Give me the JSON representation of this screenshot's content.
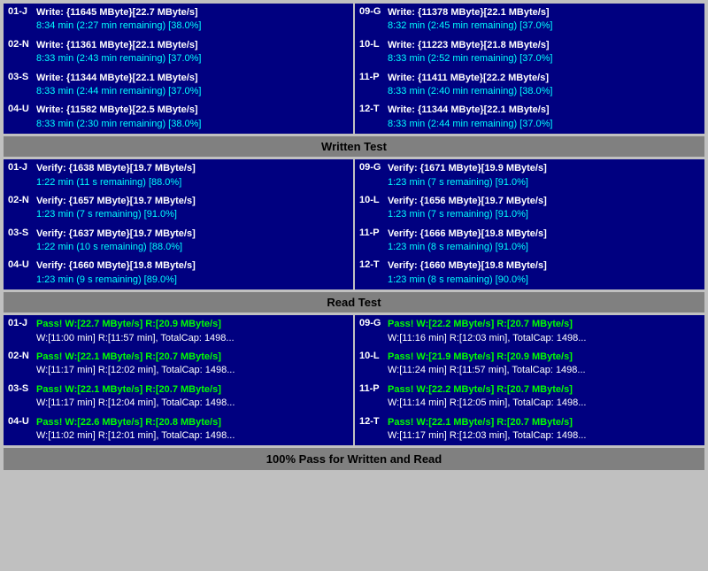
{
  "sections": {
    "write": {
      "rows_left": [
        {
          "label": "01-J",
          "line1": "Write: {11645 MByte}[22.7 MByte/s]",
          "line2": "8:34 min (2:27 min remaining)  [38.0%]"
        },
        {
          "label": "02-N",
          "line1": "Write: {11361 MByte}[22.1 MByte/s]",
          "line2": "8:33 min (2:43 min remaining)  [37.0%]"
        },
        {
          "label": "03-S",
          "line1": "Write: {11344 MByte}[22.1 MByte/s]",
          "line2": "8:33 min (2:44 min remaining)  [37.0%]"
        },
        {
          "label": "04-U",
          "line1": "Write: {11582 MByte}[22.5 MByte/s]",
          "line2": "8:33 min (2:30 min remaining)  [38.0%]"
        }
      ],
      "rows_right": [
        {
          "label": "09-G",
          "line1": "Write: {11378 MByte}[22.1 MByte/s]",
          "line2": "8:32 min (2:45 min remaining)  [37.0%]"
        },
        {
          "label": "10-L",
          "line1": "Write: {11223 MByte}[21.8 MByte/s]",
          "line2": "8:33 min (2:52 min remaining)  [37.0%]"
        },
        {
          "label": "11-P",
          "line1": "Write: {11411 MByte}[22.2 MByte/s]",
          "line2": "8:33 min (2:40 min remaining)  [38.0%]"
        },
        {
          "label": "12-T",
          "line1": "Write: {11344 MByte}[22.1 MByte/s]",
          "line2": "8:33 min (2:44 min remaining)  [37.0%]"
        }
      ],
      "header": "Written Test"
    },
    "verify": {
      "rows_left": [
        {
          "label": "01-J",
          "line1": "Verify: {1638 MByte}[19.7 MByte/s]",
          "line2": "1:22 min (11 s remaining)   [88.0%]"
        },
        {
          "label": "02-N",
          "line1": "Verify: {1657 MByte}[19.7 MByte/s]",
          "line2": "1:23 min (7 s remaining)   [91.0%]"
        },
        {
          "label": "03-S",
          "line1": "Verify: {1637 MByte}[19.7 MByte/s]",
          "line2": "1:22 min (10 s remaining)   [88.0%]"
        },
        {
          "label": "04-U",
          "line1": "Verify: {1660 MByte}[19.8 MByte/s]",
          "line2": "1:23 min (9 s remaining)   [89.0%]"
        }
      ],
      "rows_right": [
        {
          "label": "09-G",
          "line1": "Verify: {1671 MByte}[19.9 MByte/s]",
          "line2": "1:23 min (7 s remaining)   [91.0%]"
        },
        {
          "label": "10-L",
          "line1": "Verify: {1656 MByte}[19.7 MByte/s]",
          "line2": "1:23 min (7 s remaining)   [91.0%]"
        },
        {
          "label": "11-P",
          "line1": "Verify: {1666 MByte}[19.8 MByte/s]",
          "line2": "1:23 min (8 s remaining)   [91.0%]"
        },
        {
          "label": "12-T",
          "line1": "Verify: {1660 MByte}[19.8 MByte/s]",
          "line2": "1:23 min (8 s remaining)   [90.0%]"
        }
      ],
      "header": "Read Test"
    },
    "read": {
      "rows_left": [
        {
          "label": "01-J",
          "line1": "Pass! W:[22.7 MByte/s] R:[20.9 MByte/s]",
          "line2": "W:[11:00 min] R:[11:57 min], TotalCap: 1498..."
        },
        {
          "label": "02-N",
          "line1": "Pass! W:[22.1 MByte/s] R:[20.7 MByte/s]",
          "line2": "W:[11:17 min] R:[12:02 min], TotalCap: 1498..."
        },
        {
          "label": "03-S",
          "line1": "Pass! W:[22.1 MByte/s] R:[20.7 MByte/s]",
          "line2": "W:[11:17 min] R:[12:04 min], TotalCap: 1498..."
        },
        {
          "label": "04-U",
          "line1": "Pass! W:[22.6 MByte/s] R:[20.8 MByte/s]",
          "line2": "W:[11:02 min] R:[12:01 min], TotalCap: 1498..."
        }
      ],
      "rows_right": [
        {
          "label": "09-G",
          "line1": "Pass! W:[22.2 MByte/s] R:[20.7 MByte/s]",
          "line2": "W:[11:16 min] R:[12:03 min], TotalCap: 1498..."
        },
        {
          "label": "10-L",
          "line1": "Pass! W:[21.9 MByte/s] R:[20.9 MByte/s]",
          "line2": "W:[11:24 min] R:[11:57 min], TotalCap: 1498..."
        },
        {
          "label": "11-P",
          "line1": "Pass! W:[22.2 MByte/s] R:[20.7 MByte/s]",
          "line2": "W:[11:14 min] R:[12:05 min], TotalCap: 1498..."
        },
        {
          "label": "12-T",
          "line1": "Pass! W:[22.1 MByte/s] R:[20.7 MByte/s]",
          "line2": "W:[11:17 min] R:[12:03 min], TotalCap: 1498..."
        }
      ]
    },
    "footer": "100% Pass for Written and Read"
  }
}
